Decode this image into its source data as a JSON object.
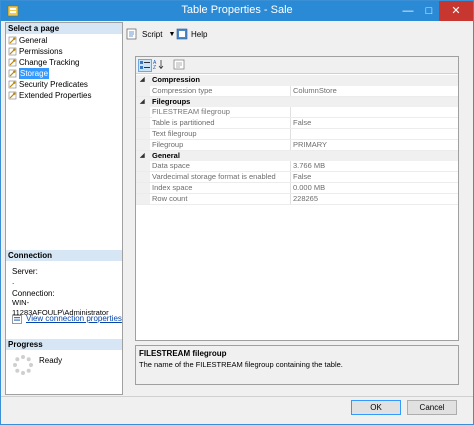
{
  "window": {
    "title": "Table Properties - Sale",
    "minimize_glyph": "—",
    "maximize_glyph": "□",
    "close_glyph": "✕"
  },
  "sidebar": {
    "select_page_header": "Select a page",
    "pages": [
      {
        "label": "General",
        "icon": "wrench-page-icon"
      },
      {
        "label": "Permissions",
        "icon": "wrench-page-icon"
      },
      {
        "label": "Change Tracking",
        "icon": "wrench-page-icon"
      },
      {
        "label": "Storage",
        "icon": "wrench-page-icon",
        "selected": true
      },
      {
        "label": "Security Predicates",
        "icon": "wrench-page-icon"
      },
      {
        "label": "Extended Properties",
        "icon": "wrench-page-icon"
      }
    ],
    "connection_header": "Connection",
    "server_label": "Server:",
    "server_value": ".",
    "connection_label": "Connection:",
    "connection_value": "WIN-11283AFOULP\\Administrator",
    "view_connection_link": "View connection properties",
    "progress_header": "Progress",
    "progress_status": "Ready"
  },
  "toolbar": {
    "script_label": "Script",
    "help_label": "Help"
  },
  "property_grid": {
    "categories": [
      {
        "name": "Compression",
        "rows": [
          {
            "name": "Compression type",
            "value": "ColumnStore"
          }
        ]
      },
      {
        "name": "Filegroups",
        "rows": [
          {
            "name": "FILESTREAM filegroup",
            "value": "",
            "selected": true
          },
          {
            "name": "Table is partitioned",
            "value": "False"
          },
          {
            "name": "Text filegroup",
            "value": ""
          },
          {
            "name": "Filegroup",
            "value": "PRIMARY"
          }
        ]
      },
      {
        "name": "General",
        "rows": [
          {
            "name": "Data space",
            "value": "3.766 MB"
          },
          {
            "name": "Vardecimal storage format is enabled",
            "value": "False"
          },
          {
            "name": "Index space",
            "value": "0.000 MB"
          },
          {
            "name": "Row count",
            "value": "228265"
          }
        ]
      }
    ]
  },
  "description": {
    "title": "FILESTREAM filegroup",
    "text": "The name of the FILESTREAM filegroup containing the table."
  },
  "buttons": {
    "ok": "OK",
    "cancel": "Cancel"
  },
  "colors": {
    "titlebar": "#2a8ad5",
    "close_button": "#c7372f",
    "selected_page": "#3399ff",
    "link": "#0645ad"
  }
}
